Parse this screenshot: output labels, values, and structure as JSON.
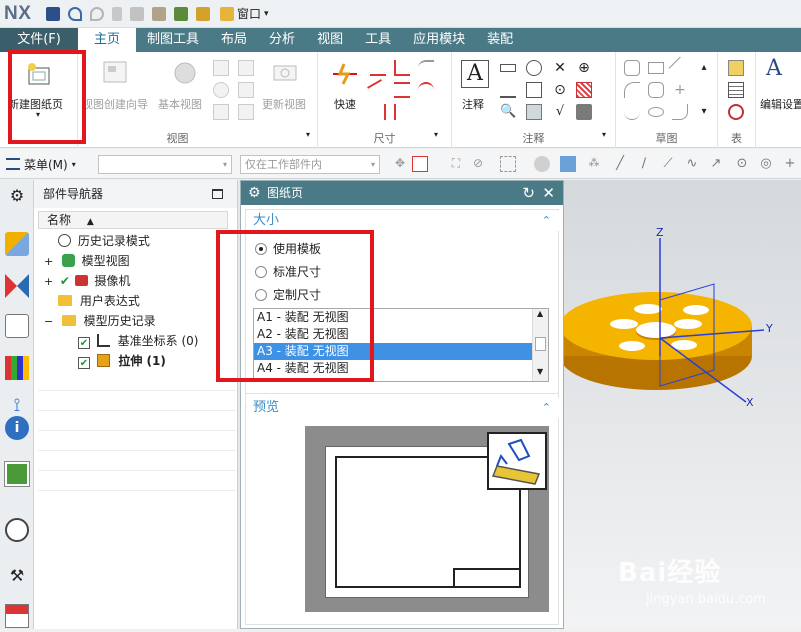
{
  "app": {
    "logo": "NX",
    "window_menu": "窗口"
  },
  "tabs": [
    {
      "label": "文件(F)"
    },
    {
      "label": "主页"
    },
    {
      "label": "制图工具"
    },
    {
      "label": "布局"
    },
    {
      "label": "分析"
    },
    {
      "label": "视图"
    },
    {
      "label": "工具"
    },
    {
      "label": "应用模块"
    },
    {
      "label": "装配"
    }
  ],
  "ribbon": {
    "new_sheet": "新建图纸页",
    "view_wizard": "视图创建向导",
    "base_view": "基本视图",
    "update_view": "更新视图",
    "group_view": "视图",
    "quick": "快速",
    "group_dim": "尺寸",
    "note": "注释",
    "group_anno": "注释",
    "group_sketch": "草图",
    "group_table": "表",
    "edit_settings": "编辑设置"
  },
  "toolbar2": {
    "menu": "菜单(M)",
    "scope": "仅在工作部件内"
  },
  "navigator": {
    "title": "部件导航器",
    "col_name": "名称",
    "items": [
      {
        "label": "历史记录模式"
      },
      {
        "label": "模型视图"
      },
      {
        "label": "摄像机"
      },
      {
        "label": "用户表达式"
      },
      {
        "label": "模型历史记录"
      },
      {
        "label": "基准坐标系 (0)"
      },
      {
        "label": "拉伸 (1)"
      }
    ]
  },
  "dialog": {
    "title": "图纸页",
    "size_section": "大小",
    "radio": [
      {
        "label": "使用模板",
        "checked": true
      },
      {
        "label": "标准尺寸",
        "checked": false
      },
      {
        "label": "定制尺寸",
        "checked": false
      }
    ],
    "templates": [
      {
        "label": "A1 - 装配 无视图"
      },
      {
        "label": "A2 - 装配 无视图"
      },
      {
        "label": "A3 - 装配 无视图"
      },
      {
        "label": "A4 - 装配 无视图"
      }
    ],
    "selected_template": "A3 - 装配 无视图",
    "preview_section": "预览"
  },
  "viewport": {
    "axis_z": "Z",
    "axis_y": "Y",
    "axis_x": "X"
  },
  "watermark": {
    "brand": "Bai经验",
    "url": "jingyan.baidu.com"
  },
  "colors": {
    "accent": "#4b7a87",
    "highlight": "#e2161b",
    "part": "#f5b400",
    "selection": "#3f91e6"
  }
}
